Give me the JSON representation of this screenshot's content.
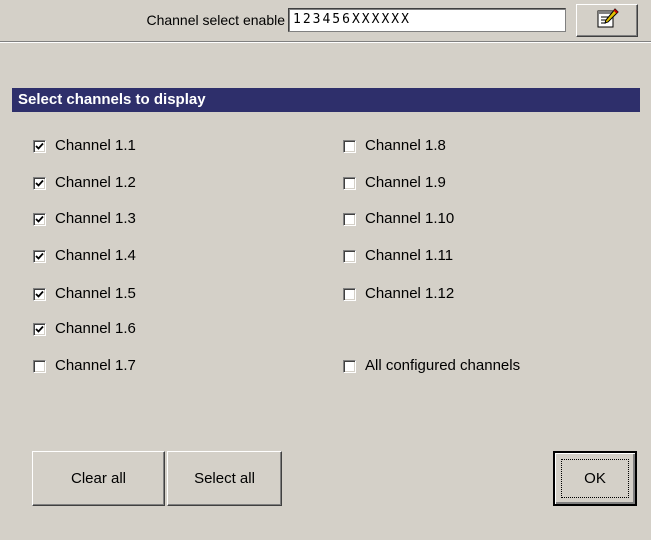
{
  "toolbar": {
    "channel_select_label": "Channel select enable",
    "channel_select_value": "123456XXXXXX",
    "edit_icon": "edit-notepad-icon"
  },
  "dialog": {
    "title": "Select channels to display",
    "left_channels": [
      {
        "label": "Channel 1.1",
        "checked": true
      },
      {
        "label": "Channel 1.2",
        "checked": true
      },
      {
        "label": "Channel 1.3",
        "checked": true
      },
      {
        "label": "Channel 1.4",
        "checked": true
      },
      {
        "label": "Channel 1.5",
        "checked": true
      },
      {
        "label": "Channel 1.6",
        "checked": true
      },
      {
        "label": "Channel 1.7",
        "checked": false
      }
    ],
    "right_channels": [
      {
        "label": "Channel 1.8",
        "checked": false
      },
      {
        "label": "Channel 1.9",
        "checked": false
      },
      {
        "label": "Channel 1.10",
        "checked": false
      },
      {
        "label": "Channel 1.11",
        "checked": false
      },
      {
        "label": "Channel 1.12",
        "checked": false
      }
    ],
    "all_configured": {
      "label": "All configured channels",
      "checked": false
    }
  },
  "buttons": {
    "clear_all": "Clear all",
    "select_all": "Select all",
    "ok": "OK"
  },
  "colors": {
    "face": "#d4d0c8",
    "header": "#2e2f6b",
    "header_text": "#ffffff"
  }
}
